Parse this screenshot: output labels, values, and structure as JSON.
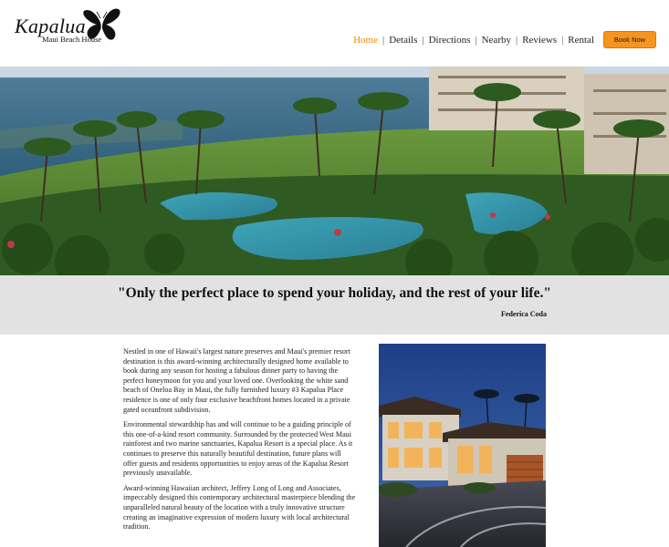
{
  "logo": {
    "title": "Kapalua",
    "subtitle": "Maui Beach House"
  },
  "nav": {
    "items": [
      {
        "label": "Home",
        "active": true
      },
      {
        "label": "Details",
        "active": false
      },
      {
        "label": "Directions",
        "active": false
      },
      {
        "label": "Nearby",
        "active": false
      },
      {
        "label": "Reviews",
        "active": false
      },
      {
        "label": "Rental",
        "active": false
      }
    ],
    "separator": "|"
  },
  "book_button": {
    "label": "Book Now"
  },
  "colors": {
    "accent": "#f08a00",
    "button": "#f7941d",
    "quote_band": "#e2e2e2"
  },
  "quote": {
    "text": "\"Only the perfect place to spend your holiday, and the rest of your life.\"",
    "author": "Federica Coda"
  },
  "content": {
    "paragraphs": [
      "Nestled in one of Hawaii's largest nature preserves and Maui's premier resort destination is this award-winning architecturally designed home available to book during any season for hosting a fabulous dinner party to having the perfect honeymoon for you and your loved one. Overlooking the white sand beach of Oneloa Bay in Maui, the fully furnished luxury #3 Kapalua Place residence is one of only four exclusive beachfront homes located in a private gated oceanfront subdivision.",
      "Environmental stewardship has and will continue to be a guiding principle of this one-of-a-kind resort community. Surrounded by the protected West Maui rainforest and two marine sanctuaries, Kapalua Resort is a special place. As it continues to preserve this naturally beautiful destination, future plans will offer guests and residents opportunities to enjoy areas of the Kapalua Resort previously unavailable.",
      "Award-winning Hawaiian architect, Jeffery Long of Long and Associates, impeccably designed this contemporary architectural masterpiece blending the unparalleled natural beauty of the location with a truly innovative structure creating an imaginative expression of modern luxury with local architectural tradition."
    ]
  }
}
